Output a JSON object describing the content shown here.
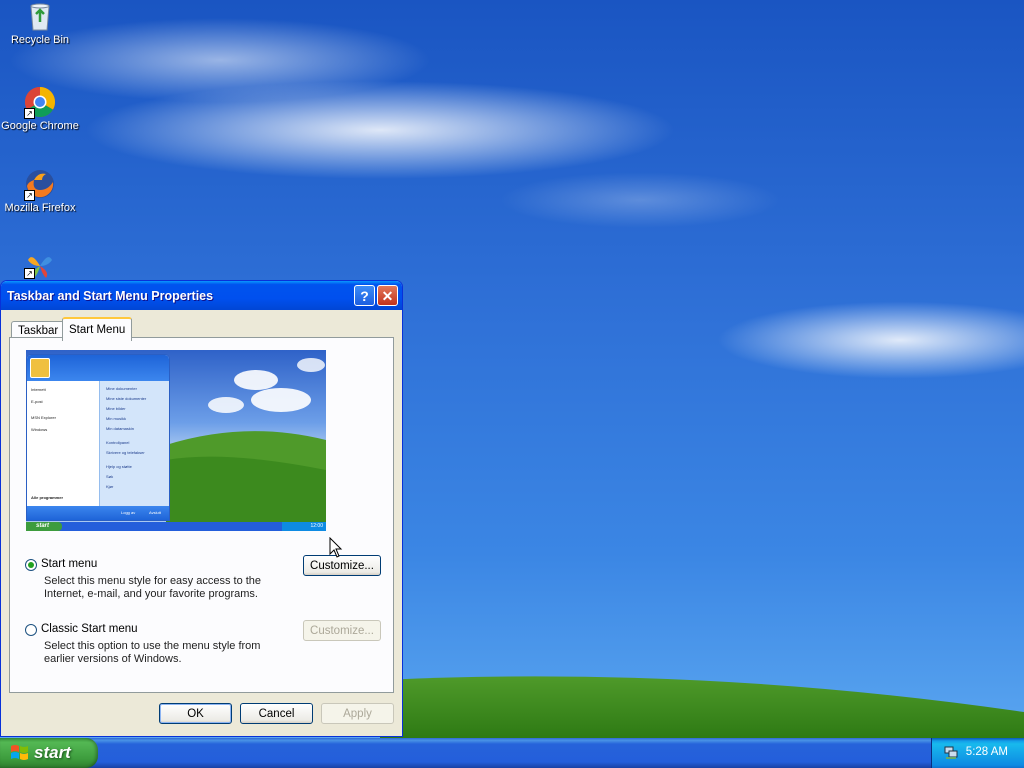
{
  "desktop": {
    "icons": [
      {
        "label": "Recycle Bin"
      },
      {
        "label": "Google Chrome"
      },
      {
        "label": "Mozilla Firefox"
      },
      {
        "label": ""
      }
    ]
  },
  "dialog": {
    "title": "Taskbar and Start Menu Properties",
    "help_glyph": "?",
    "close_glyph": "✕",
    "tabs": [
      {
        "label": "Taskbar",
        "active": false
      },
      {
        "label": "Start Menu",
        "active": true
      }
    ],
    "preview": {
      "start_label": "start",
      "all_programs": "Alle programmer",
      "left_items": [
        "Internett",
        "E-post",
        "MSN Explorer",
        "Windows"
      ],
      "right_items": [
        "Mine dokumenter",
        "Mine siste dokumenter",
        "Mine bilder",
        "Min musikk",
        "Min datamaskin",
        "Kontrollpanel",
        "Skrivere og telefakser",
        "Hjelp og støtte",
        "Søk",
        "Kjør"
      ],
      "logoff": "Logg av",
      "shutdown": "Avslutt",
      "clock": "12:00"
    },
    "options": [
      {
        "label": "Start menu",
        "selected": true,
        "description": "Select this menu style for easy access to the Internet, e-mail, and your favorite programs.",
        "customize": "Customize...",
        "customize_enabled": true
      },
      {
        "label": "Classic Start menu",
        "selected": false,
        "description": "Select this option to use the menu style from earlier versions of Windows.",
        "customize": "Customize...",
        "customize_enabled": false
      }
    ],
    "buttons": {
      "ok": "OK",
      "cancel": "Cancel",
      "apply": "Apply"
    }
  },
  "taskbar": {
    "start_label": "start",
    "clock": "5:28 AM"
  },
  "colors": {
    "titlebar": "#0053ee",
    "start_button": "#3d9c3d",
    "taskbar": "#245edb",
    "tray": "#0e8be3"
  }
}
